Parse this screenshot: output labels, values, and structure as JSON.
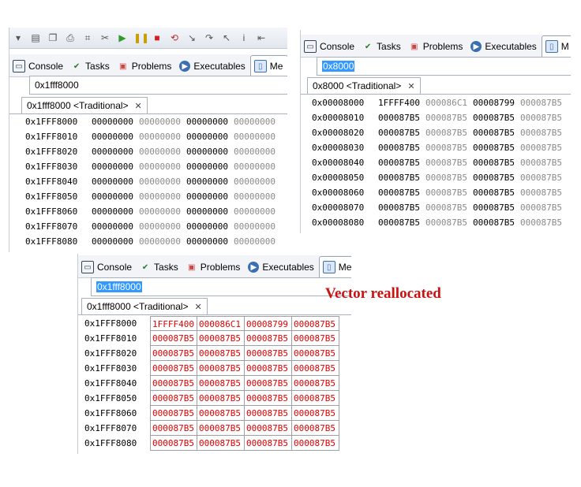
{
  "toolbar_icons": [
    "dropdown-arrow-icon",
    "save-icon",
    "copy-icon",
    "print-icon",
    "hex-icon",
    "disconnect-icon",
    "resume-icon",
    "suspend-icon",
    "terminate-icon",
    "relaunch-icon",
    "step-into-icon",
    "step-over-icon",
    "step-return-icon",
    "instruction-step-icon",
    "drop-to-frame-icon"
  ],
  "tabs": {
    "console": "Console",
    "tasks": "Tasks",
    "problems": "Problems",
    "executables": "Executables",
    "memory": "Me",
    "memory_right": "M"
  },
  "left": {
    "address": "0x1fff8000",
    "rendering_tab": "0x1fff8000 <Traditional>",
    "rows": [
      {
        "addr": "0x1FFF8000",
        "v": [
          "00000000",
          "00000000",
          "00000000",
          "00000000"
        ]
      },
      {
        "addr": "0x1FFF8010",
        "v": [
          "00000000",
          "00000000",
          "00000000",
          "00000000"
        ]
      },
      {
        "addr": "0x1FFF8020",
        "v": [
          "00000000",
          "00000000",
          "00000000",
          "00000000"
        ]
      },
      {
        "addr": "0x1FFF8030",
        "v": [
          "00000000",
          "00000000",
          "00000000",
          "00000000"
        ]
      },
      {
        "addr": "0x1FFF8040",
        "v": [
          "00000000",
          "00000000",
          "00000000",
          "00000000"
        ]
      },
      {
        "addr": "0x1FFF8050",
        "v": [
          "00000000",
          "00000000",
          "00000000",
          "00000000"
        ]
      },
      {
        "addr": "0x1FFF8060",
        "v": [
          "00000000",
          "00000000",
          "00000000",
          "00000000"
        ]
      },
      {
        "addr": "0x1FFF8070",
        "v": [
          "00000000",
          "00000000",
          "00000000",
          "00000000"
        ]
      },
      {
        "addr": "0x1FFF8080",
        "v": [
          "00000000",
          "00000000",
          "00000000",
          "00000000"
        ]
      }
    ]
  },
  "right": {
    "address": "0x8000",
    "rendering_tab": "0x8000 <Traditional>",
    "rows": [
      {
        "addr": "0x00008000",
        "v": [
          "1FFFF400",
          "000086C1",
          "00008799",
          "000087B5"
        ]
      },
      {
        "addr": "0x00008010",
        "v": [
          "000087B5",
          "000087B5",
          "000087B5",
          "000087B5"
        ]
      },
      {
        "addr": "0x00008020",
        "v": [
          "000087B5",
          "000087B5",
          "000087B5",
          "000087B5"
        ]
      },
      {
        "addr": "0x00008030",
        "v": [
          "000087B5",
          "000087B5",
          "000087B5",
          "000087B5"
        ]
      },
      {
        "addr": "0x00008040",
        "v": [
          "000087B5",
          "000087B5",
          "000087B5",
          "000087B5"
        ]
      },
      {
        "addr": "0x00008050",
        "v": [
          "000087B5",
          "000087B5",
          "000087B5",
          "000087B5"
        ]
      },
      {
        "addr": "0x00008060",
        "v": [
          "000087B5",
          "000087B5",
          "000087B5",
          "000087B5"
        ]
      },
      {
        "addr": "0x00008070",
        "v": [
          "000087B5",
          "000087B5",
          "000087B5",
          "000087B5"
        ]
      },
      {
        "addr": "0x00008080",
        "v": [
          "000087B5",
          "000087B5",
          "000087B5",
          "000087B5"
        ]
      }
    ]
  },
  "bottom": {
    "address": "0x1fff8000",
    "rendering_tab": "0x1fff8000 <Traditional>",
    "caption": "Vector reallocated",
    "rows": [
      {
        "addr": "0x1FFF8000",
        "v": [
          "1FFFF400",
          "000086C1",
          "00008799",
          "000087B5"
        ]
      },
      {
        "addr": "0x1FFF8010",
        "v": [
          "000087B5",
          "000087B5",
          "000087B5",
          "000087B5"
        ]
      },
      {
        "addr": "0x1FFF8020",
        "v": [
          "000087B5",
          "000087B5",
          "000087B5",
          "000087B5"
        ]
      },
      {
        "addr": "0x1FFF8030",
        "v": [
          "000087B5",
          "000087B5",
          "000087B5",
          "000087B5"
        ]
      },
      {
        "addr": "0x1FFF8040",
        "v": [
          "000087B5",
          "000087B5",
          "000087B5",
          "000087B5"
        ]
      },
      {
        "addr": "0x1FFF8050",
        "v": [
          "000087B5",
          "000087B5",
          "000087B5",
          "000087B5"
        ]
      },
      {
        "addr": "0x1FFF8060",
        "v": [
          "000087B5",
          "000087B5",
          "000087B5",
          "000087B5"
        ]
      },
      {
        "addr": "0x1FFF8070",
        "v": [
          "000087B5",
          "000087B5",
          "000087B5",
          "000087B5"
        ]
      },
      {
        "addr": "0x1FFF8080",
        "v": [
          "000087B5",
          "000087B5",
          "000087B5",
          "000087B5"
        ]
      }
    ]
  },
  "colors": {
    "changed": "#e00000",
    "selection": "#3399ff"
  }
}
